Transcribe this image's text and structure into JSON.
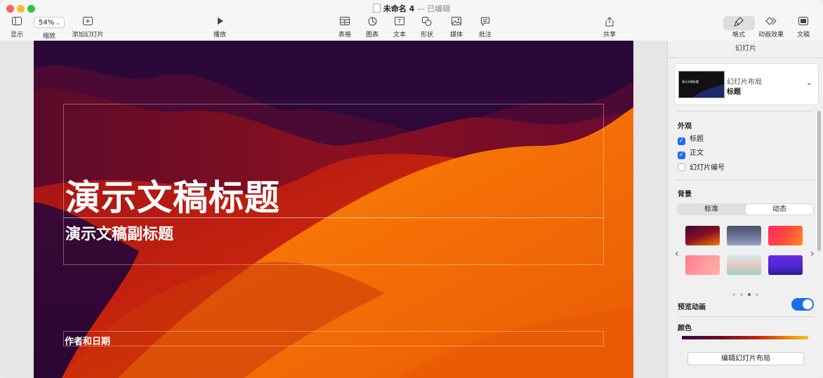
{
  "window": {
    "doc_title": "未命名 4",
    "separator": "—",
    "edit_status": "已编辑"
  },
  "toolbar": {
    "view_label": "显示",
    "zoom_value": "54%",
    "zoom_label": "缩放",
    "add_slide_label": "添加幻灯片",
    "play_label": "播放",
    "table_label": "表格",
    "chart_label": "图表",
    "text_label": "文本",
    "shape_label": "形状",
    "media_label": "媒体",
    "comment_label": "批注",
    "share_label": "共享",
    "format_label": "格式",
    "animate_label": "动画效果",
    "document_label": "文稿"
  },
  "slide": {
    "title": "演示文稿标题",
    "subtitle": "演示文稿副标题",
    "author": "作者和日期"
  },
  "sidebar": {
    "header": "幻灯片",
    "layout_label": "幻灯片布局",
    "layout_value": "标题",
    "layout_thumb_title": "演示文稿标题",
    "appearance_title": "外观",
    "appearance": [
      {
        "label": "标题",
        "checked": true
      },
      {
        "label": "正文",
        "checked": true
      },
      {
        "label": "幻灯片编号",
        "checked": false
      }
    ],
    "background_title": "背景",
    "bg_tabs": [
      "标准",
      "动态"
    ],
    "bg_selected_tab": "动态",
    "page_count": 4,
    "active_page": 3,
    "preview_animation_label": "预览动画",
    "preview_animation_on": true,
    "color_title": "颜色",
    "edit_layout_button": "编辑幻灯片布局"
  },
  "colors": {
    "accent": "#1a6cf0",
    "slide_orange": "#f47b06",
    "slide_purple": "#2a0a3a"
  }
}
